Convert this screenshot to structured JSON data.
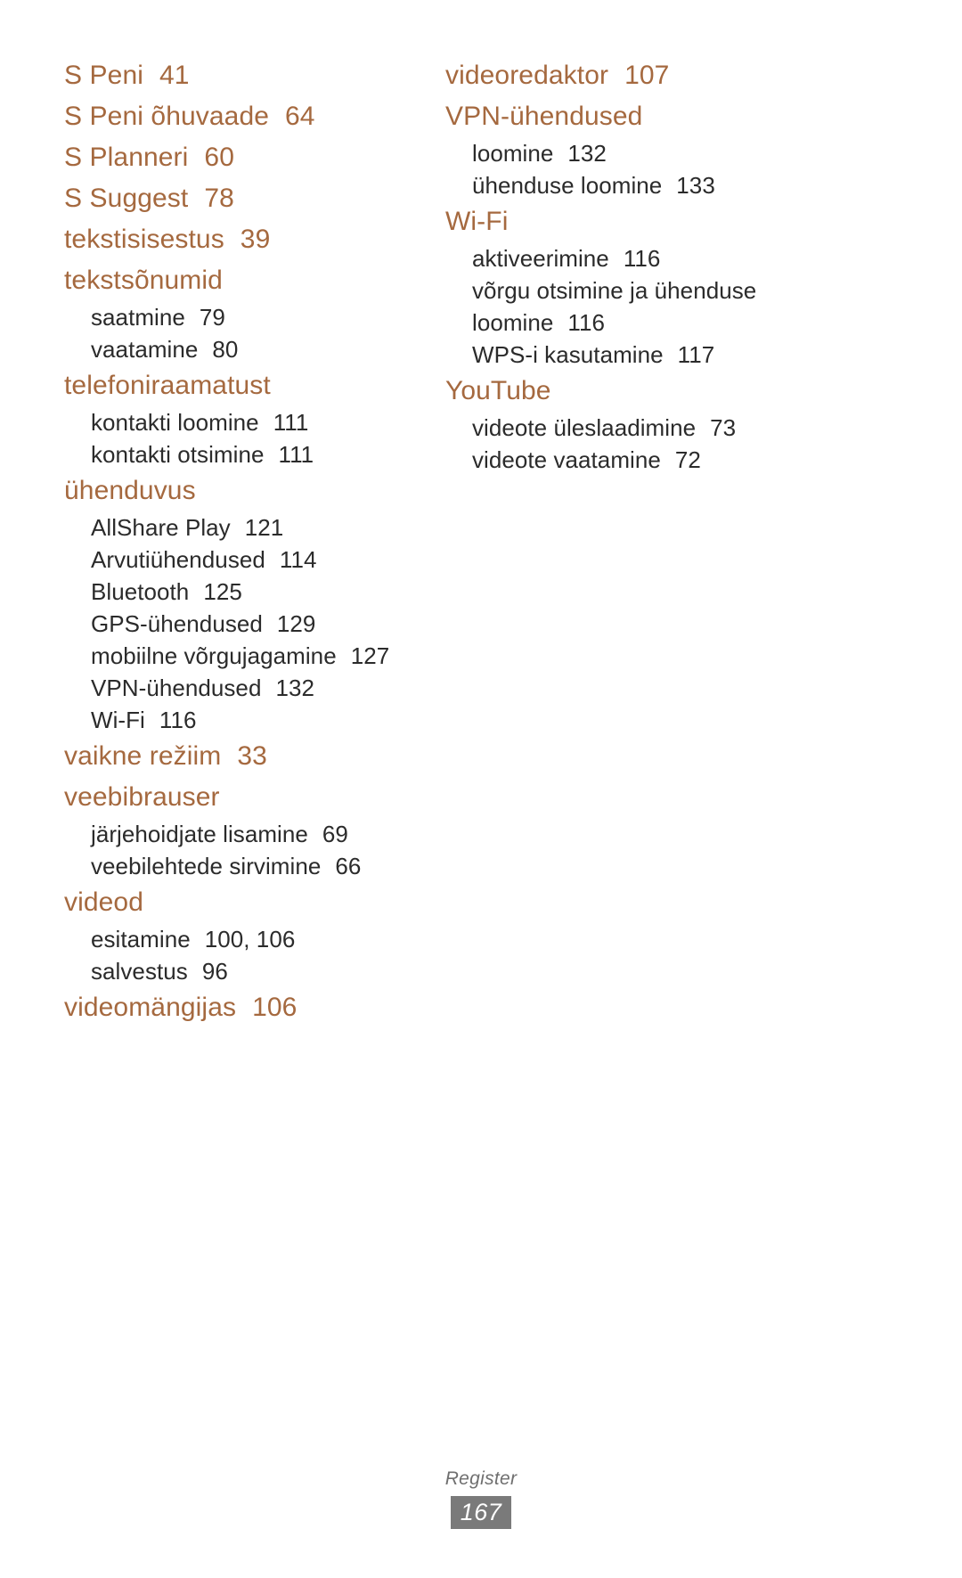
{
  "document": {
    "footer_label": "Register",
    "page_number": "167",
    "heading_color": "#a5693f",
    "subentry_color": "#2b2b2b",
    "footer_box_color": "#7a7a7a"
  },
  "columns": {
    "left": [
      {
        "type": "heading",
        "label": "S Peni",
        "page": "41",
        "subs": []
      },
      {
        "type": "heading",
        "label": "S Peni õhuvaade",
        "page": "64",
        "subs": []
      },
      {
        "type": "heading",
        "label": "S Planneri",
        "page": "60",
        "subs": []
      },
      {
        "type": "heading",
        "label": "S Suggest",
        "page": "78",
        "subs": []
      },
      {
        "type": "heading",
        "label": "tekstisisestus",
        "page": "39",
        "subs": []
      },
      {
        "type": "heading",
        "label": "tekstsõnumid",
        "page": "",
        "subs": [
          {
            "label": "saatmine",
            "page": "79"
          },
          {
            "label": "vaatamine",
            "page": "80"
          }
        ]
      },
      {
        "type": "heading",
        "label": "telefoniraamatust",
        "page": "",
        "subs": [
          {
            "label": "kontakti loomine",
            "page": "111"
          },
          {
            "label": "kontakti otsimine",
            "page": "111"
          }
        ]
      },
      {
        "type": "heading",
        "label": "ühenduvus",
        "page": "",
        "subs": [
          {
            "label": "AllShare Play",
            "page": "121"
          },
          {
            "label": "Arvutiühendused",
            "page": "114"
          },
          {
            "label": "Bluetooth",
            "page": "125"
          },
          {
            "label": "GPS-ühendused",
            "page": "129"
          },
          {
            "label": "mobiilne võrgujagamine",
            "page": "127",
            "wrap": true
          },
          {
            "label": "VPN-ühendused",
            "page": "132"
          },
          {
            "label": "Wi-Fi",
            "page": "116"
          }
        ]
      },
      {
        "type": "heading",
        "label": "vaikne režiim",
        "page": "33",
        "subs": []
      },
      {
        "type": "heading",
        "label": "veebibrauser",
        "page": "",
        "subs": [
          {
            "label": "järjehoidjate lisamine",
            "page": "69"
          },
          {
            "label": "veebilehtede sirvimine",
            "page": "66"
          }
        ]
      },
      {
        "type": "heading",
        "label": "videod",
        "page": "",
        "subs": [
          {
            "label": "esitamine",
            "page": "100, 106"
          },
          {
            "label": "salvestus",
            "page": "96"
          }
        ]
      },
      {
        "type": "heading",
        "label": "videomängijas",
        "page": "106",
        "subs": []
      }
    ],
    "right": [
      {
        "type": "heading",
        "label": "videoredaktor",
        "page": "107",
        "subs": []
      },
      {
        "type": "heading",
        "label": "VPN-ühendused",
        "page": "",
        "subs": [
          {
            "label": "loomine",
            "page": "132"
          },
          {
            "label": "ühenduse loomine",
            "page": "133"
          }
        ]
      },
      {
        "type": "heading",
        "label": "Wi-Fi",
        "page": "",
        "subs": [
          {
            "label": "aktiveerimine",
            "page": "116"
          },
          {
            "label": "võrgu otsimine ja ühenduse loomine",
            "page": "116",
            "wrap": true
          },
          {
            "label": "WPS-i kasutamine",
            "page": "117"
          }
        ]
      },
      {
        "type": "heading",
        "label": "YouTube",
        "page": "",
        "subs": [
          {
            "label": "videote üleslaadimine",
            "page": "73"
          },
          {
            "label": "videote vaatamine",
            "page": "72"
          }
        ]
      }
    ]
  }
}
